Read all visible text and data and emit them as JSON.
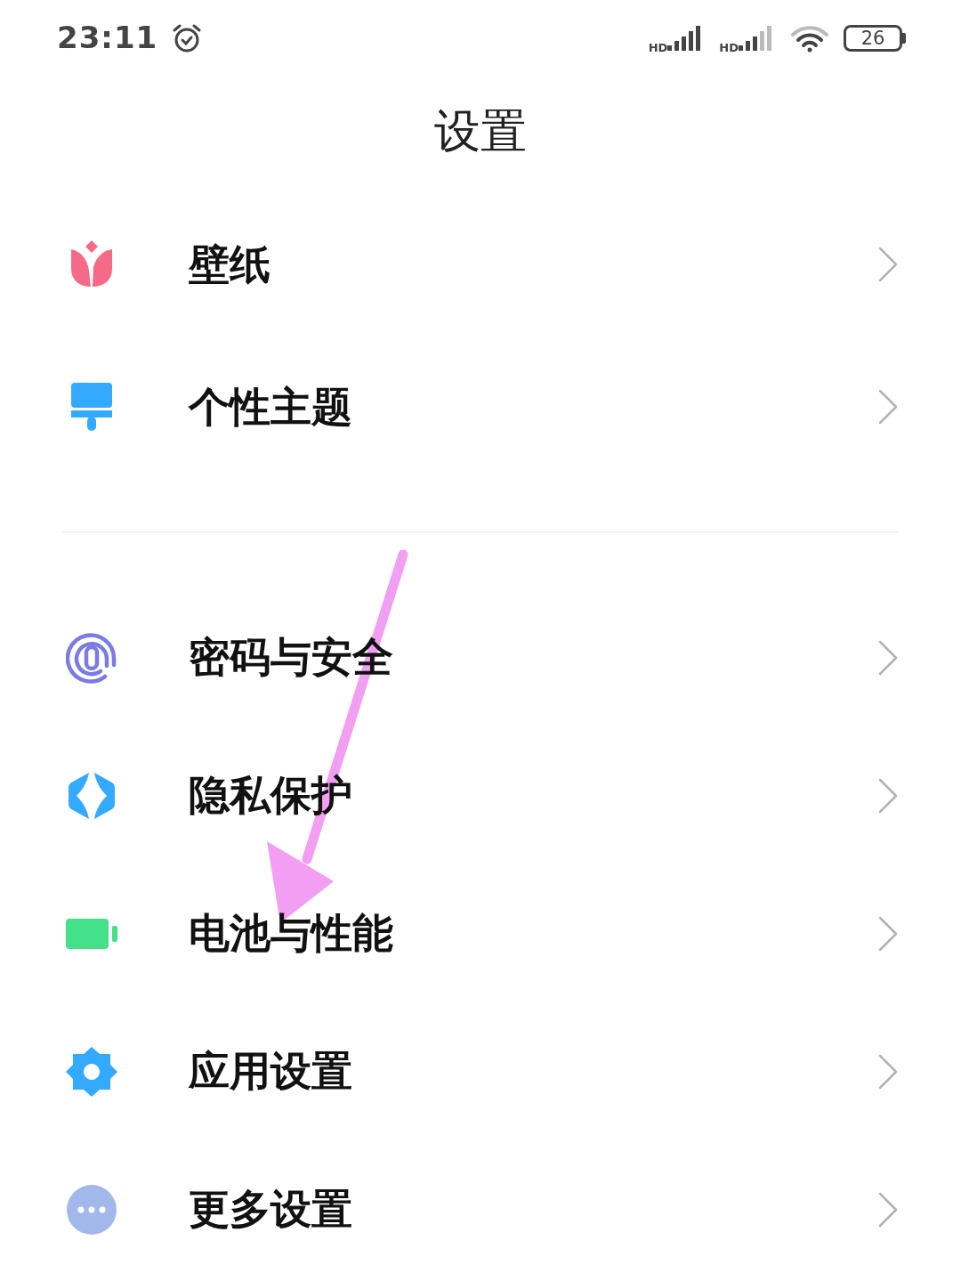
{
  "status_bar": {
    "time": "23:11",
    "signals": [
      "HD",
      "HD"
    ],
    "battery": "26"
  },
  "title": "设置",
  "groups": [
    {
      "items": [
        {
          "label": "壁纸",
          "kind": "tulip"
        },
        {
          "label": "个性主题",
          "kind": "brush"
        }
      ]
    },
    {
      "items": [
        {
          "label": "密码与安全",
          "kind": "fingerprint"
        },
        {
          "label": "隐私保护",
          "kind": "shield"
        },
        {
          "label": "电池与性能",
          "kind": "battery"
        },
        {
          "label": "应用设置",
          "kind": "gear"
        },
        {
          "label": "更多设置",
          "kind": "more"
        }
      ]
    }
  ]
}
